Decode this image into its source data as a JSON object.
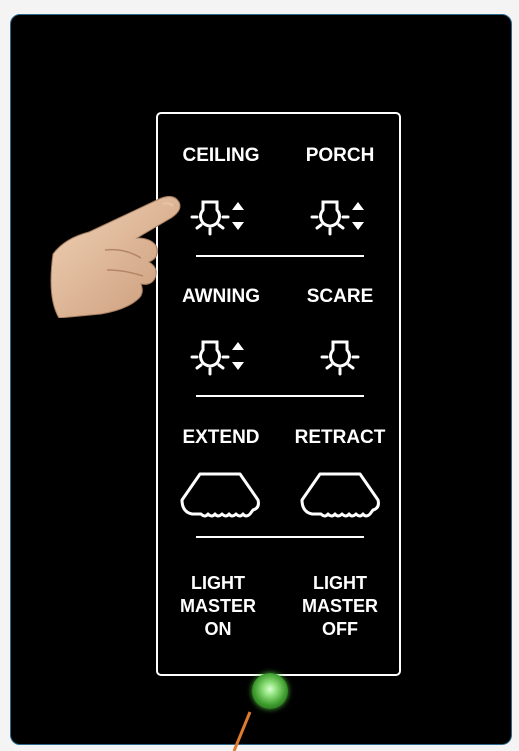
{
  "panel": {
    "rows": [
      {
        "left": "CEILING",
        "right": "PORCH"
      },
      {
        "left": "AWNING",
        "right": "SCARE"
      },
      {
        "left": "EXTEND",
        "right": "RETRACT"
      }
    ],
    "master_on": [
      "LIGHT",
      "MASTER",
      "ON"
    ],
    "master_off": [
      "LIGHT",
      "MASTER",
      "OFF"
    ]
  },
  "icons": {
    "ceiling": "bulb-dimmer-icon",
    "porch": "bulb-dimmer-icon",
    "awning": "bulb-dimmer-icon",
    "scare": "bulb-icon",
    "extend": "awning-extend-icon",
    "retract": "awning-retract-icon"
  },
  "colors": {
    "background": "#000000",
    "foreground": "#ffffff",
    "device_border": "#2b6a8c",
    "led": "#4db23a",
    "cable": "#e07a2c"
  }
}
